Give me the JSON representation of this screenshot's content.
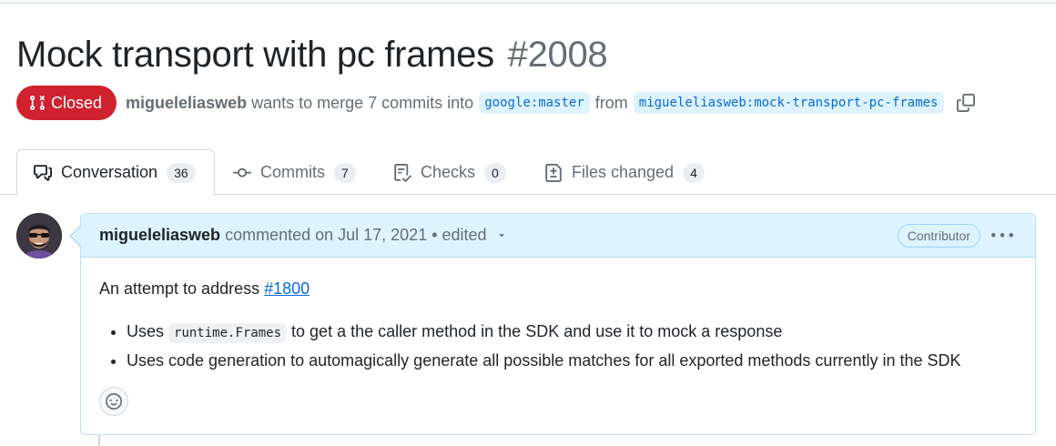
{
  "pr": {
    "title": "Mock transport with pc frames",
    "number": "#2008",
    "state": "Closed",
    "author": "migueleliasweb",
    "merge_text": "wants to merge 7 commits into",
    "base_branch": "google:master",
    "from_text": "from",
    "head_branch": "migueleliasweb:mock-transport-pc-frames"
  },
  "tabs": [
    {
      "label": "Conversation",
      "count": "36",
      "icon": "comment-discussion-icon"
    },
    {
      "label": "Commits",
      "count": "7",
      "icon": "git-commit-icon"
    },
    {
      "label": "Checks",
      "count": "0",
      "icon": "checklist-icon"
    },
    {
      "label": "Files changed",
      "count": "4",
      "icon": "file-diff-icon"
    }
  ],
  "comment": {
    "author": "migueleliasweb",
    "meta": "commented on Jul 17, 2021 • edited",
    "role": "Contributor",
    "intro": "An attempt to address ",
    "issue_link": "#1800",
    "bullet1_pre": "Uses ",
    "bullet1_code": "runtime.Frames",
    "bullet1_post": " to get a the caller method in the SDK and use it to mock a response",
    "bullet2": "Uses code generation to automagically generate all possible matches for all exported methods currently in the SDK"
  },
  "colors": {
    "closed": "#cf222e",
    "link": "#0969da",
    "header_bg": "#ddf4ff"
  }
}
